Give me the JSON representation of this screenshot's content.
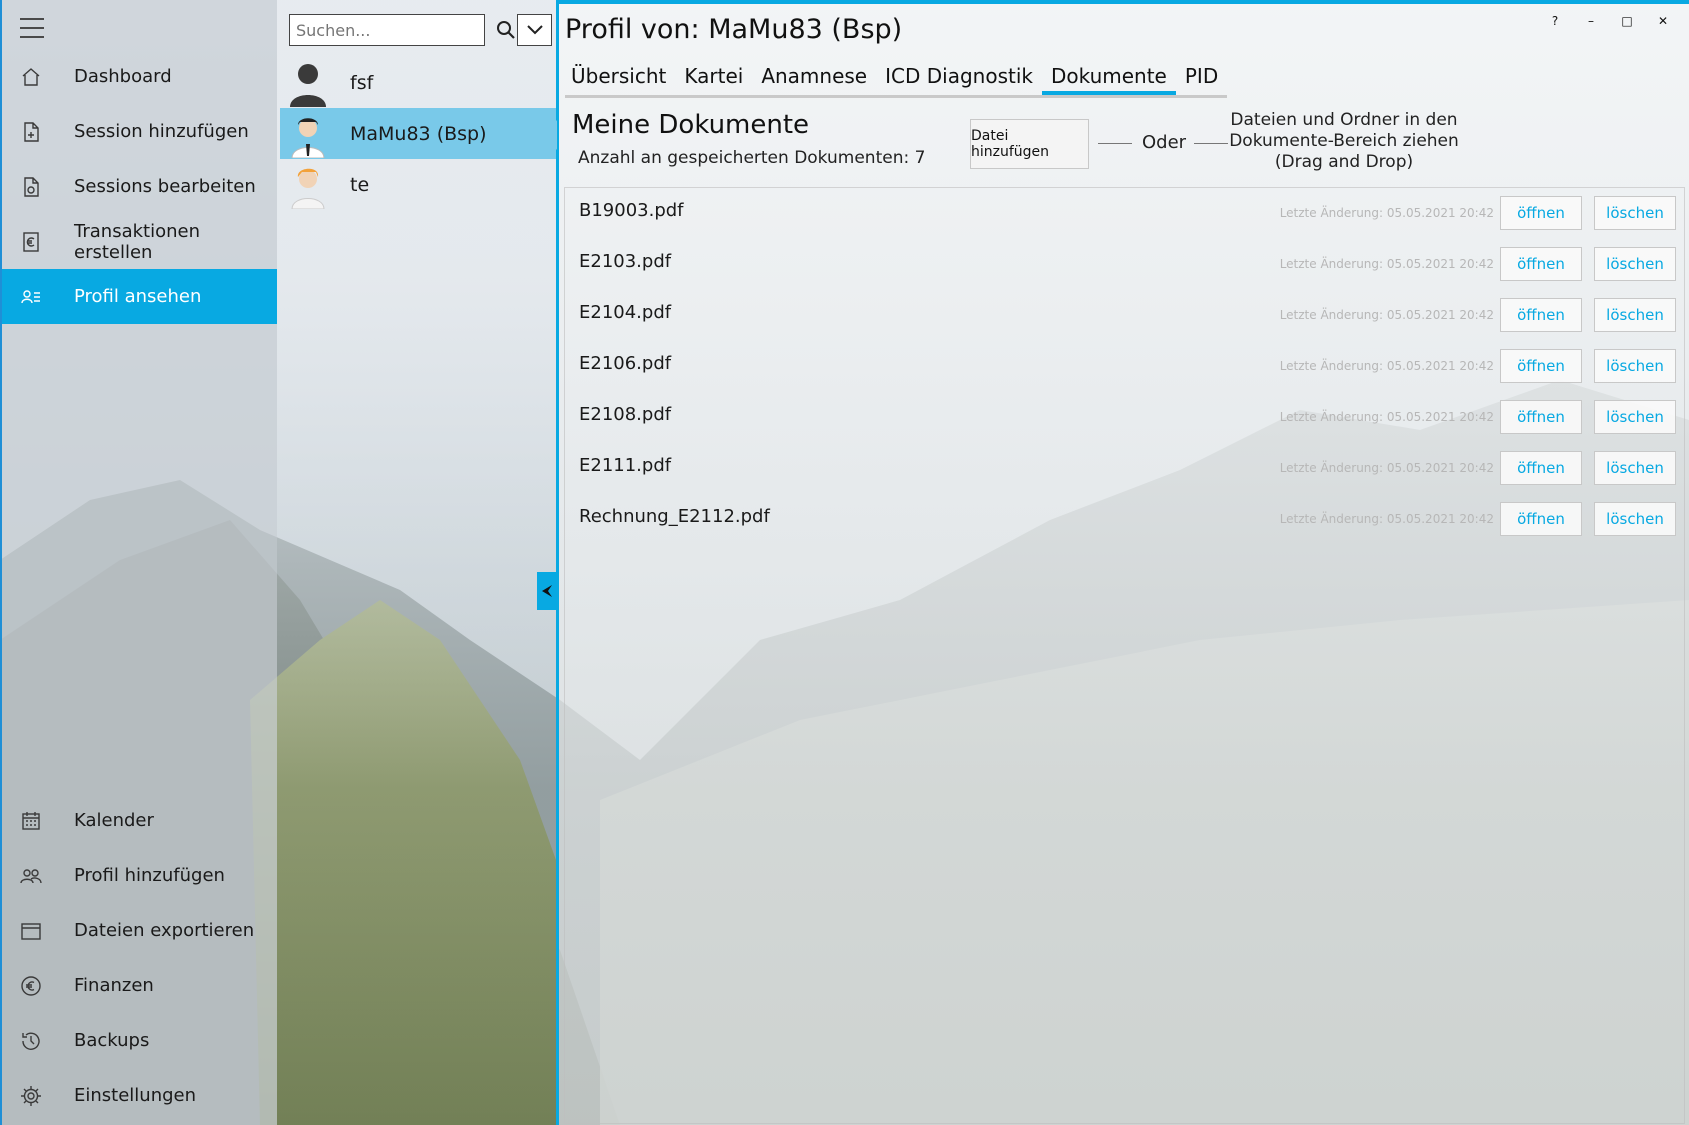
{
  "window": {
    "title": "Profil von: MaMu83 (Bsp)",
    "controls": [
      "?",
      "–",
      "□",
      "✕"
    ]
  },
  "nav": {
    "top_items": [
      {
        "label": "Dashboard",
        "icon": "home-icon"
      },
      {
        "label": "Session hinzufügen",
        "icon": "document-add-icon"
      },
      {
        "label": "Sessions bearbeiten",
        "icon": "document-edit-icon"
      },
      {
        "label": "Transaktionen erstellen",
        "icon": "euro-document-icon"
      },
      {
        "label": "Profil ansehen",
        "icon": "profile-list-icon",
        "active": true
      }
    ],
    "bottom_items": [
      {
        "label": "Kalender",
        "icon": "calendar-icon"
      },
      {
        "label": "Profil hinzufügen",
        "icon": "add-users-icon"
      },
      {
        "label": "Dateien exportieren",
        "icon": "export-box-icon"
      },
      {
        "label": "Finanzen",
        "icon": "euro-circle-icon"
      },
      {
        "label": "Backups",
        "icon": "history-icon"
      },
      {
        "label": "Einstellungen",
        "icon": "gear-icon"
      }
    ]
  },
  "profiles": {
    "search_placeholder": "Suchen...",
    "items": [
      {
        "name": "fsf",
        "avatar": "silhouette-avatar"
      },
      {
        "name": "MaMu83 (Bsp)",
        "avatar": "businessman-avatar",
        "selected": true
      },
      {
        "name": "te",
        "avatar": "blonde-avatar"
      }
    ]
  },
  "tabs": [
    {
      "label": "Übersicht"
    },
    {
      "label": "Kartei"
    },
    {
      "label": "Anamnese"
    },
    {
      "label": "ICD Diagnostik"
    },
    {
      "label": "Dokumente",
      "active": true
    },
    {
      "label": "PID"
    }
  ],
  "documents": {
    "title": "Meine Dokumente",
    "count_text": "Anzahl an gespeicherten Dokumenten: 7",
    "add_button": "Datei hinzufügen",
    "or_text": "Oder",
    "dnd_text": [
      "Dateien und Ordner in den",
      "Dokumente-Bereich ziehen",
      "(Drag and Drop)"
    ],
    "open_label": "öffnen",
    "delete_label": "löschen",
    "items": [
      {
        "name": "B19003.pdf",
        "modified": "Letzte Änderung: 05.05.2021 20:42"
      },
      {
        "name": "E2103.pdf",
        "modified": "Letzte Änderung: 05.05.2021 20:42"
      },
      {
        "name": "E2104.pdf",
        "modified": "Letzte Änderung: 05.05.2021 20:42"
      },
      {
        "name": "E2106.pdf",
        "modified": "Letzte Änderung: 05.05.2021 20:42"
      },
      {
        "name": "E2108.pdf",
        "modified": "Letzte Änderung: 05.05.2021 20:42"
      },
      {
        "name": "E2111.pdf",
        "modified": "Letzte Änderung: 05.05.2021 20:42"
      },
      {
        "name": "Rechnung_E2112.pdf",
        "modified": "Letzte Änderung: 05.05.2021 20:42"
      }
    ]
  },
  "colors": {
    "accent": "#08a9e2",
    "selected_profile": "#79c9e9"
  }
}
